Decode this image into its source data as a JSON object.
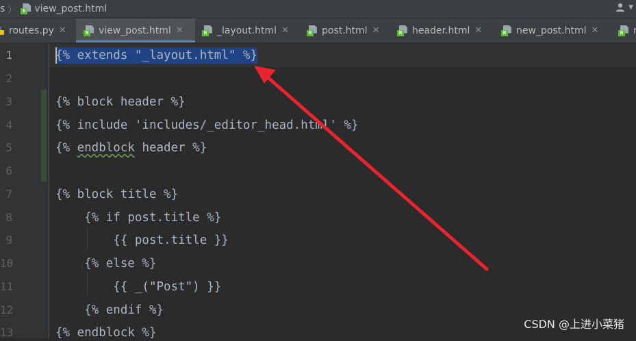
{
  "breadcrumb": {
    "prev": "s",
    "file": "view_post.html"
  },
  "tabs": [
    {
      "label": "routes.py",
      "icon": "python-file-icon"
    },
    {
      "label": "view_post.html",
      "icon": "html-file-icon",
      "active": true
    },
    {
      "label": "_layout.html",
      "icon": "html-file-icon"
    },
    {
      "label": "post.html",
      "icon": "html-file-icon"
    },
    {
      "label": "header.html",
      "icon": "html-file-icon"
    },
    {
      "label": "new_post.html",
      "icon": "html-file-icon"
    },
    {
      "label": "r",
      "icon": "html-file-icon"
    }
  ],
  "tab_close": "✕",
  "gutter": {
    "lines": [
      "1",
      "2",
      "3",
      "4",
      "5",
      "6",
      "7",
      "8",
      "9",
      "10",
      "11",
      "12",
      "13"
    ]
  },
  "code": [
    "{% extends \"_layout.html\" %}",
    "",
    "{% block header %}",
    "{% include 'includes/_editor_head.html' %}",
    "{% endblock header %}",
    "",
    "{% block title %}",
    "    {% if post.title %}",
    "        {{ post.title }}",
    "    {% else %}",
    "        {{ _(\"Post\") }}",
    "    {% endif %}",
    "{% endblock %}"
  ],
  "code_parts": {
    "line5_a": "{% ",
    "line5_b": "endblock",
    "line5_c": " header %}"
  },
  "watermark": "CSDN @上进小菜猪",
  "colors": {
    "selection": "#214283",
    "arrow": "#e8242e",
    "tab_accent": "#4a88c7",
    "html_badge": "#62b543"
  }
}
